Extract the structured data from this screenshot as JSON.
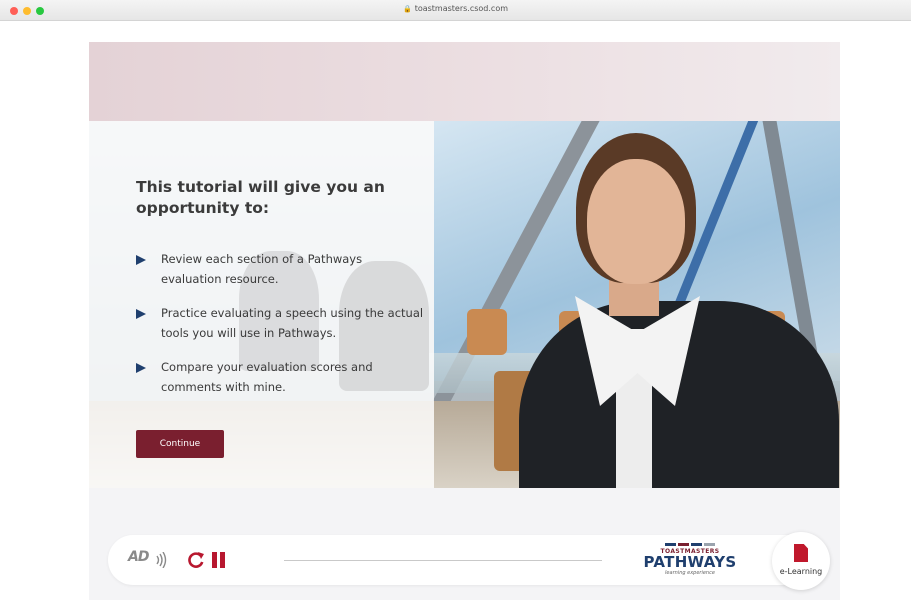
{
  "browser": {
    "url": "toastmasters.csod.com"
  },
  "panel": {
    "title": "This tutorial will give you an opportunity to:",
    "bullets": [
      "Review each section of a Pathways evaluation resource.",
      "Practice evaluating a speech using the actual tools you will use in Pathways.",
      "Compare your evaluation scores and comments with mine."
    ],
    "continue_label": "Continue"
  },
  "player": {
    "audio_description_label": "AD",
    "icons": [
      "audio-description-icon",
      "replay-icon",
      "pause-icon",
      "document-icon"
    ],
    "progress": 0.0,
    "logo": {
      "top": "TOASTMASTERS",
      "main": "PATHWAYS",
      "sub": "learning experience"
    },
    "elearning_label": "e-Learning"
  },
  "colors": {
    "accent": "#7a1f2f",
    "navy": "#1f3f6e",
    "pause_red": "#b8182f",
    "logo_bars": [
      "#1f3f6e",
      "#7a1f2f",
      "#1f3f6e",
      "#9aa3ad"
    ]
  }
}
